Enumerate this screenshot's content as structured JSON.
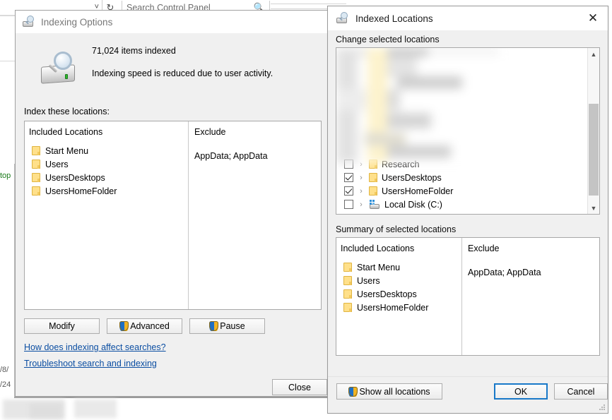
{
  "background": {
    "control_panel": {
      "search_placeholder": "Search Control Panel",
      "chevron_icon": "chevron-down-icon",
      "refresh_icon": "refresh-icon",
      "search_icon": "search-icon"
    },
    "left_fragment_text": "top",
    "date_fragment_1": "/8/",
    "date_fragment_2": "/24"
  },
  "indexing_options": {
    "title": "Indexing Options",
    "title_icon": "drive-search-icon",
    "status_icon": "indexing-drive-icon",
    "items_indexed": "71,024 items indexed",
    "speed_note": "Indexing speed is reduced due to user activity.",
    "section_label": "Index these locations:",
    "table": {
      "col_included": "Included Locations",
      "col_exclude": "Exclude",
      "included": [
        {
          "name": "Start Menu",
          "icon": "folder-icon"
        },
        {
          "name": "Users",
          "icon": "folder-icon"
        },
        {
          "name": "UsersDesktops",
          "icon": "folder-icon"
        },
        {
          "name": "UsersHomeFolder",
          "icon": "folder-icon"
        }
      ],
      "exclude_value": "AppData; AppData"
    },
    "buttons": {
      "modify": "Modify",
      "advanced": "Advanced",
      "pause": "Pause",
      "close": "Close"
    },
    "links": {
      "how_does": "How does indexing affect searches?",
      "troubleshoot": "Troubleshoot search and indexing"
    }
  },
  "indexed_locations": {
    "title": "Indexed Locations",
    "title_icon": "drive-search-icon",
    "close_icon": "close-icon",
    "change_group_label": "Change selected locations",
    "tree": {
      "rows": [
        {
          "name": "Research",
          "checked": false,
          "icon": "folder-icon",
          "expand_icon": "chevron-right-icon",
          "obscured": true
        },
        {
          "name": "UsersDesktops",
          "checked": true,
          "icon": "folder-icon",
          "expand_icon": "chevron-right-icon",
          "obscured": false
        },
        {
          "name": "UsersHomeFolder",
          "checked": true,
          "icon": "folder-icon",
          "expand_icon": "chevron-right-icon",
          "obscured": false
        },
        {
          "name": "Local Disk (C:)",
          "checked": false,
          "icon": "disk-icon",
          "expand_icon": "chevron-right-icon",
          "obscured": false
        }
      ],
      "scroll_up_icon": "chevron-up-icon",
      "scroll_down_icon": "chevron-down-icon"
    },
    "summary_group_label": "Summary of selected locations",
    "summary": {
      "col_included": "Included Locations",
      "col_exclude": "Exclude",
      "included": [
        {
          "name": "Start Menu",
          "icon": "folder-icon"
        },
        {
          "name": "Users",
          "icon": "folder-icon"
        },
        {
          "name": "UsersDesktops",
          "icon": "folder-icon"
        },
        {
          "name": "UsersHomeFolder",
          "icon": "folder-icon"
        }
      ],
      "exclude_value": "AppData; AppData"
    },
    "buttons": {
      "show_all": "Show all locations",
      "ok": "OK",
      "cancel": "Cancel"
    }
  },
  "colors": {
    "dialog_face": "#f0f0f0",
    "link": "#0b4ea2",
    "focus_border": "#1878c8",
    "folder": "#ffe08a",
    "shield_blue": "#1e6fc4",
    "shield_gold": "#f0b323"
  }
}
